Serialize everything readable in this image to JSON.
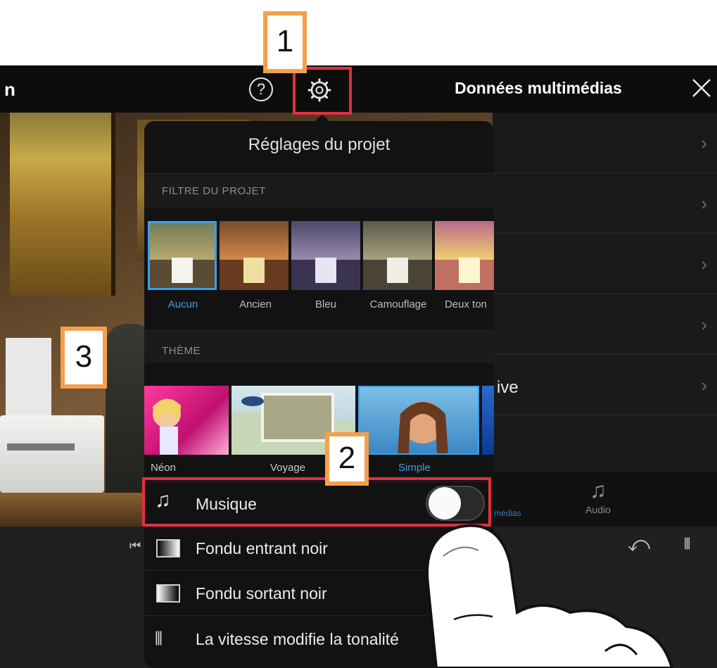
{
  "header": {
    "left_fragment": "n",
    "help_glyph": "?",
    "media_title": "Données multimédias",
    "close_glyph": "✕"
  },
  "media_panel": {
    "chevron": "›",
    "partial_row_text": "ive",
    "tabs": {
      "media_fragment": "médias",
      "audio_label": "Audio",
      "audio_glyph": "♫"
    }
  },
  "timeline": {
    "skip_glyph": "⏮",
    "undo_glyph": "⤺",
    "waveform_glyph": "⫴"
  },
  "settings_popover": {
    "title": "Réglages du projet",
    "filter_section": "FILTRE DU PROJET",
    "filters": [
      "Aucun",
      "Ancien",
      "Bleu",
      "Camouflage",
      "Deux ton"
    ],
    "selected_filter": "Aucun",
    "theme_section": "THÈME",
    "themes": [
      "Néon",
      "Voyage",
      "Simple"
    ],
    "selected_theme": "Simple",
    "rows": {
      "music": "Musique",
      "fade_in": "Fondu entrant noir",
      "fade_out": "Fondu sortant noir",
      "speed_pitch": "La vitesse modifie la tonalité"
    },
    "music_glyph": "♫",
    "wave_glyph": "⫴",
    "music_enabled": false
  },
  "tutorial_steps": [
    "1",
    "2",
    "3"
  ],
  "colors": {
    "accent_blue": "#3aa0e8",
    "highlight_red": "#e03040",
    "badge_orange": "#f4a04a"
  }
}
